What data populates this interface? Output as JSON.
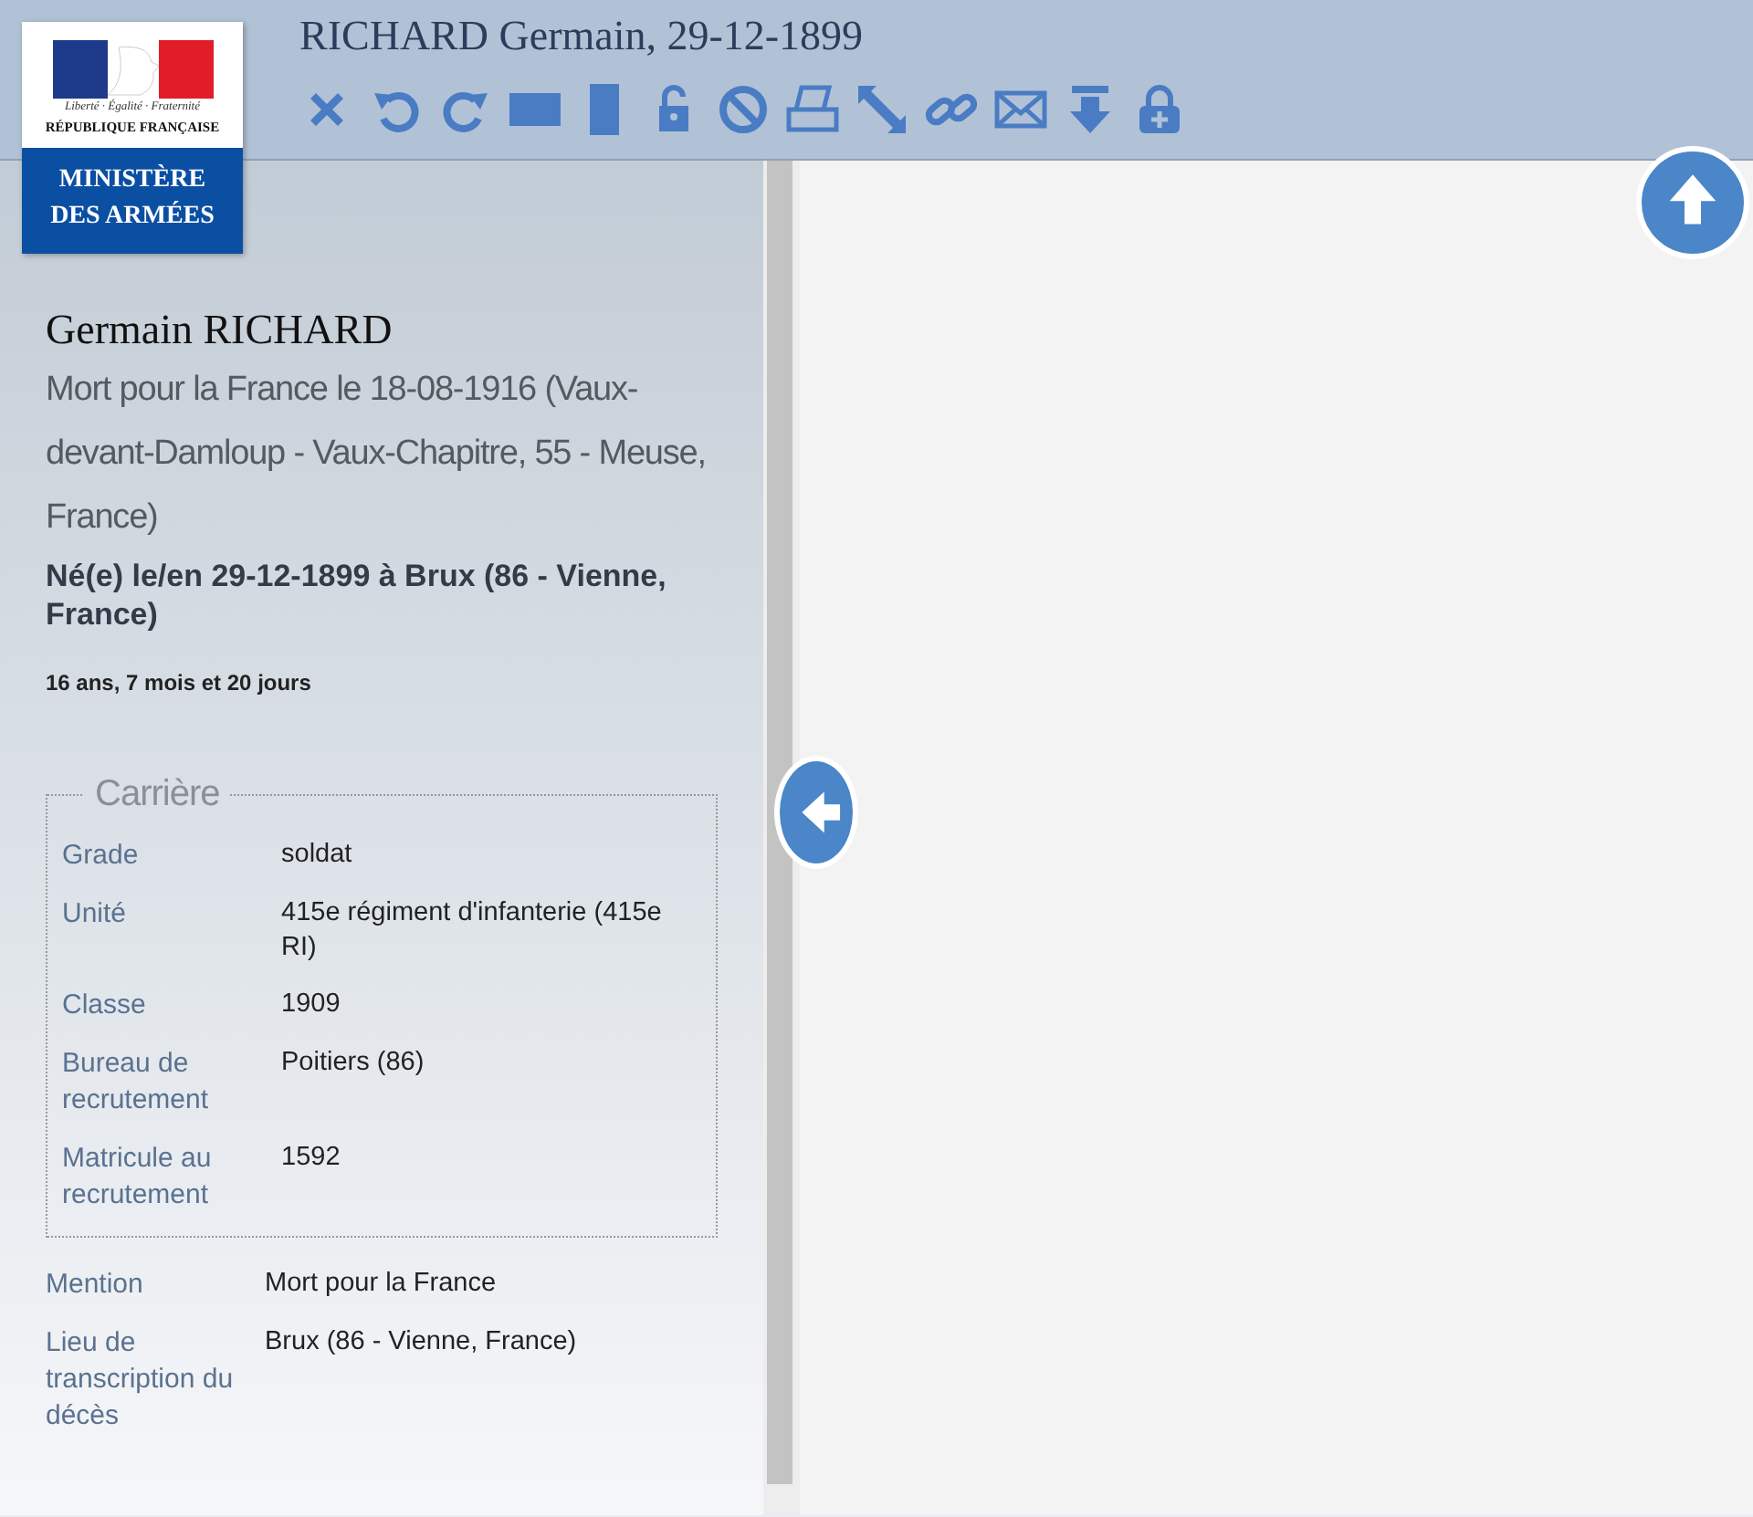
{
  "header": {
    "title": "RICHARD Germain, 29-12-1899"
  },
  "logo": {
    "motto": "Liberté · Égalité · Fraternité",
    "republic": "RÉPUBLIQUE FRANÇAISE",
    "ministry": [
      "MINISTÈRE",
      "DES ARMÉES"
    ]
  },
  "person": {
    "name": "Germain RICHARD",
    "death": "Mort pour la France le 18-08-1916 (Vaux-devant-Damloup - Vaux-Chapitre, 55 - Meuse, France)",
    "birth": "Né(e) le/en 29-12-1899 à Brux (86 - Vienne, France)",
    "age": "16 ans, 7 mois et 20 jours"
  },
  "career": {
    "legend": "Carrière",
    "rows": [
      {
        "label": "Grade",
        "value": "soldat"
      },
      {
        "label": "Unité",
        "value": "415e régiment d'infanterie (415e RI)"
      },
      {
        "label": "Classe",
        "value": "1909"
      },
      {
        "label": "Bureau de recrutement",
        "value": "Poitiers (86)"
      },
      {
        "label": "Matricule au recrutement",
        "value": "1592"
      }
    ]
  },
  "details": [
    {
      "label": "Mention",
      "value": "Mort pour la France"
    },
    {
      "label": "Lieu de transcription du décès",
      "value": "Brux (86 - Vienne, France)"
    }
  ]
}
